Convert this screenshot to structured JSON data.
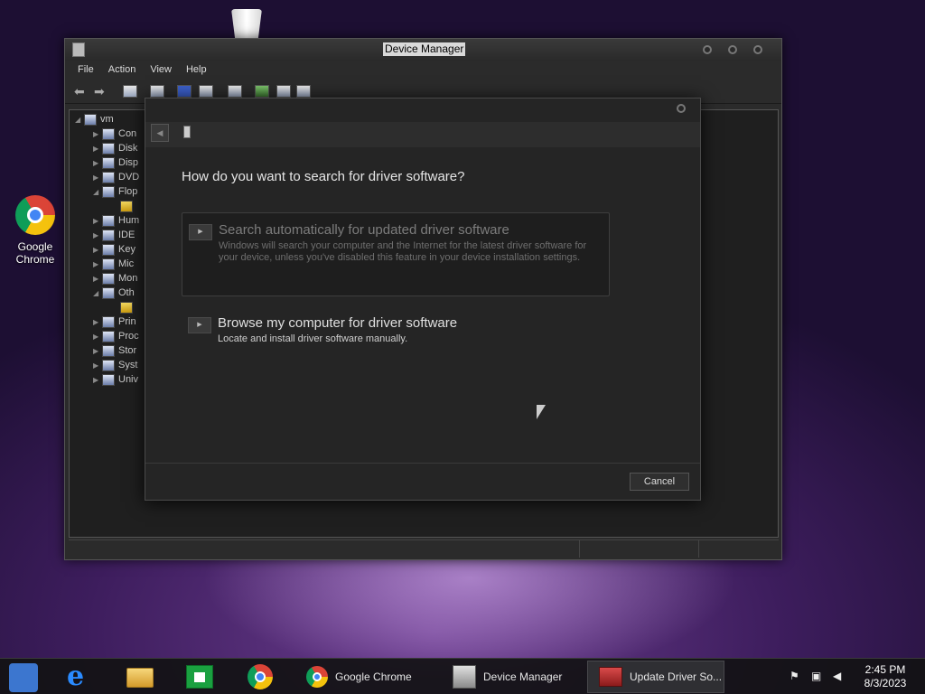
{
  "desktop": {
    "icons": [
      {
        "label": "Google Chrome"
      }
    ]
  },
  "device_manager": {
    "title": "Device Manager",
    "menu": [
      "File",
      "Action",
      "View",
      "Help"
    ],
    "tree": [
      {
        "label": "vm",
        "expander": "collapse",
        "icon": "computer-icon"
      },
      {
        "label": "Con",
        "expander": "expand",
        "icon": "computer-icon"
      },
      {
        "label": "Disk",
        "expander": "expand",
        "icon": "disk-drive-icon"
      },
      {
        "label": "Disp",
        "expander": "expand",
        "icon": "display-adapter-icon"
      },
      {
        "label": "DVD",
        "expander": "expand",
        "icon": "dvd-drive-icon"
      },
      {
        "label": "Flop",
        "expander": "collapse",
        "icon": "floppy-controller-icon"
      },
      {
        "label": "",
        "expander": "none",
        "icon": "warning-device-icon"
      },
      {
        "label": "Hum",
        "expander": "expand",
        "icon": "hid-icon"
      },
      {
        "label": "IDE",
        "expander": "expand",
        "icon": "ide-controller-icon"
      },
      {
        "label": "Key",
        "expander": "expand",
        "icon": "keyboard-icon"
      },
      {
        "label": "Mic",
        "expander": "expand",
        "icon": "mouse-icon"
      },
      {
        "label": "Mon",
        "expander": "expand",
        "icon": "monitor-icon"
      },
      {
        "label": "Oth",
        "expander": "collapse",
        "icon": "unknown-device-icon"
      },
      {
        "label": "",
        "expander": "none",
        "icon": "warning-device-icon"
      },
      {
        "label": "Prin",
        "expander": "expand",
        "icon": "printer-icon"
      },
      {
        "label": "Proc",
        "expander": "expand",
        "icon": "processor-icon"
      },
      {
        "label": "Stor",
        "expander": "expand",
        "icon": "storage-controller-icon"
      },
      {
        "label": "Syst",
        "expander": "expand",
        "icon": "system-device-icon"
      },
      {
        "label": "Univ",
        "expander": "expand",
        "icon": "usb-icon"
      }
    ]
  },
  "update_driver": {
    "heading": "How do you want to search for driver software?",
    "options": [
      {
        "title": "Search automatically for updated driver software",
        "description": "Windows will search your computer and the Internet for the latest driver software for your device, unless you've disabled this feature in your device installation settings.",
        "enabled": false
      },
      {
        "title": "Browse my computer for driver software",
        "description": "Locate and install driver software manually.",
        "enabled": true
      }
    ],
    "cancel_label": "Cancel"
  },
  "taskbar": {
    "pinned": [
      "chrome-app-launcher-icon",
      "internet-explorer-icon",
      "file-explorer-icon",
      "store-icon",
      "chrome-icon"
    ],
    "tasks": [
      {
        "label": "Google Chrome",
        "icon": "chrome-icon"
      },
      {
        "label": "Device Manager",
        "icon": "device-manager-icon"
      },
      {
        "label": "Update Driver So...",
        "icon": "update-driver-icon",
        "active": true
      }
    ],
    "tray_icons": [
      "action-center-flag-icon",
      "network-disconnected-icon",
      "volume-muted-icon"
    ],
    "clock": {
      "time": "2:45 PM",
      "date": "8/3/2023"
    }
  }
}
